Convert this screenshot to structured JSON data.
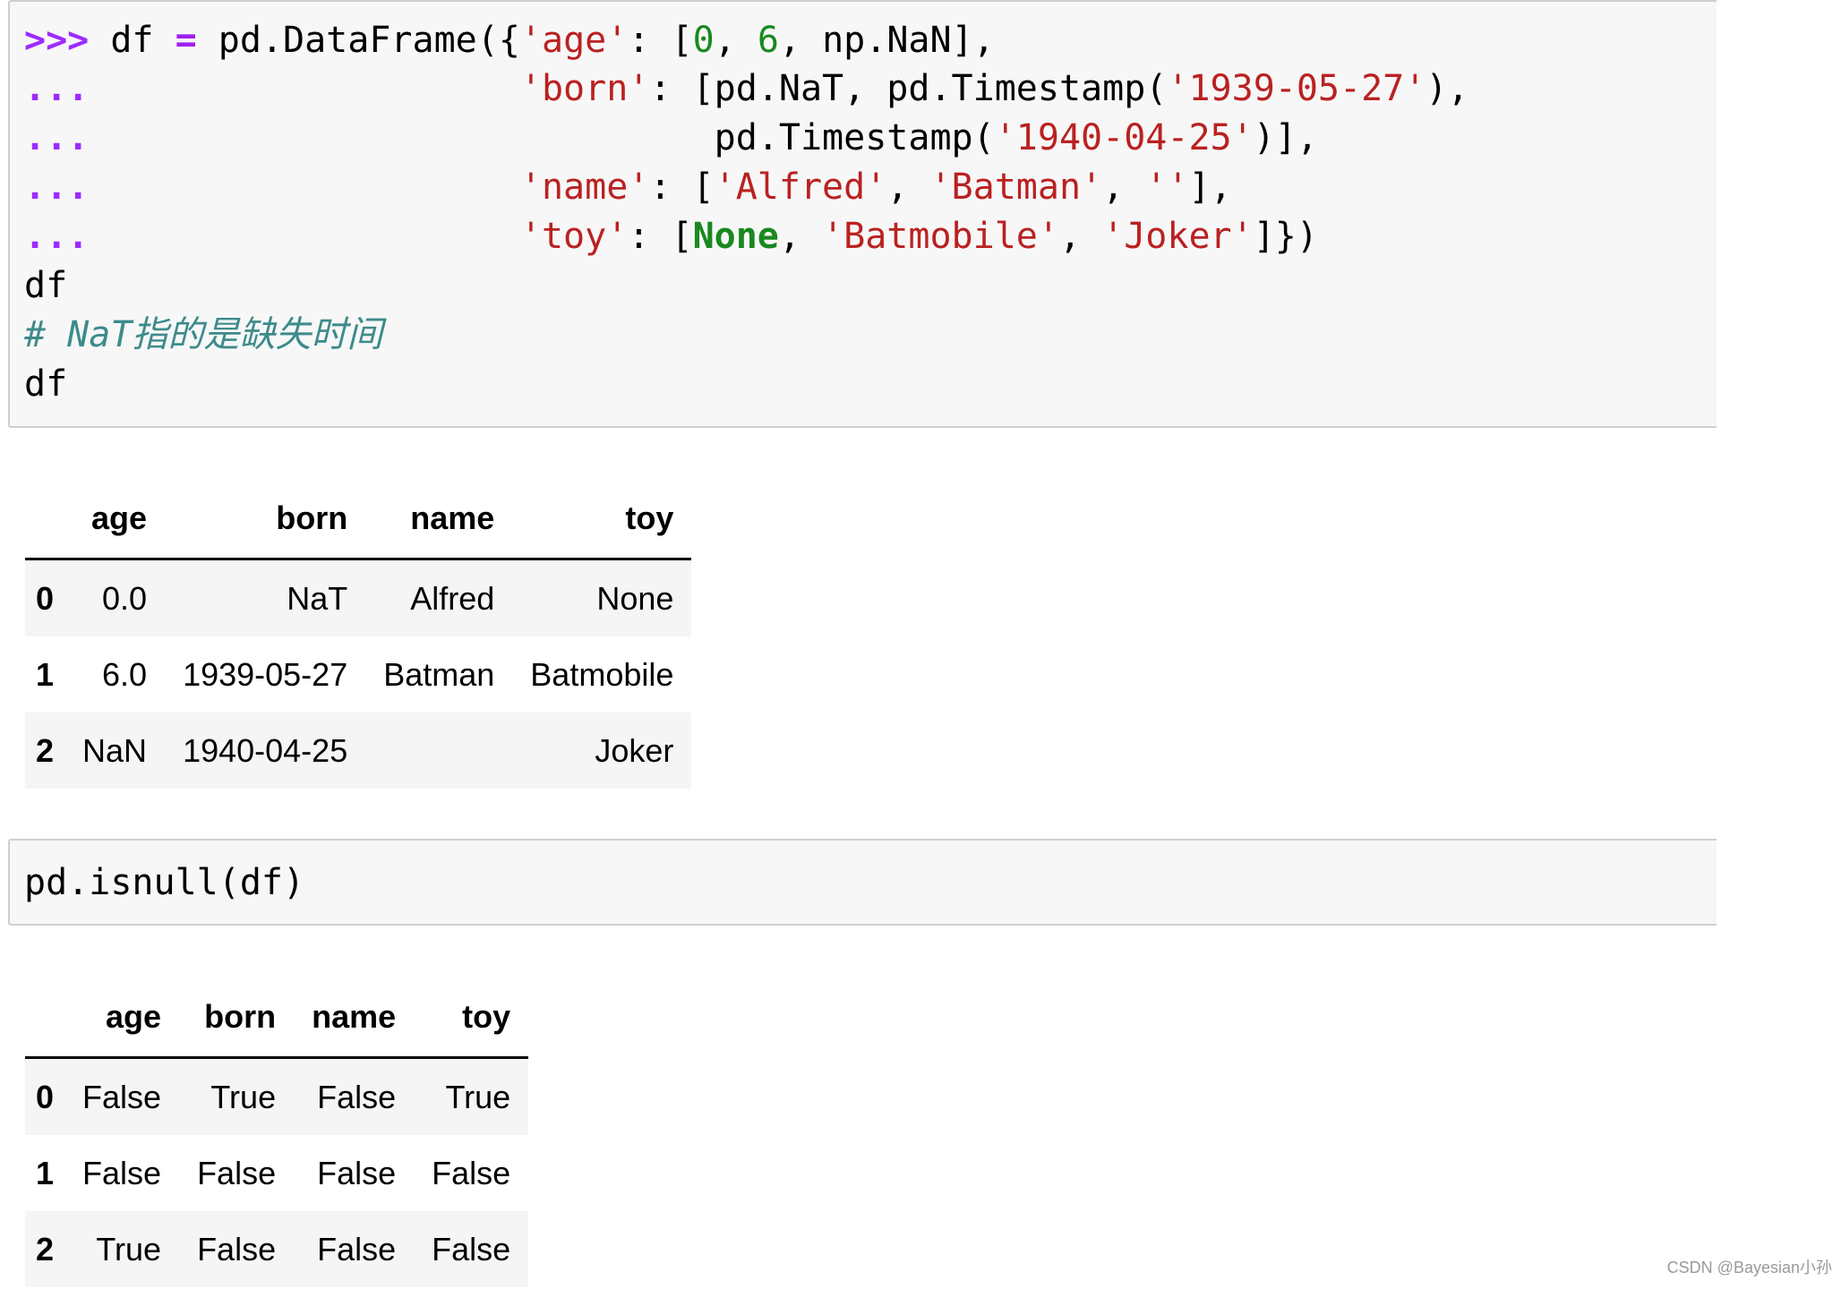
{
  "cell1": {
    "lines": [
      [
        {
          "t": ">>>",
          "c": "prompt"
        },
        {
          "t": " df "
        },
        {
          "t": "=",
          "c": "op"
        },
        {
          "t": " pd.DataFrame({"
        },
        {
          "t": "'age'",
          "c": "str"
        },
        {
          "t": ": ["
        },
        {
          "t": "0",
          "c": "num"
        },
        {
          "t": ", "
        },
        {
          "t": "6",
          "c": "num"
        },
        {
          "t": ", np.NaN],"
        }
      ],
      [
        {
          "t": "...",
          "c": "cont"
        },
        {
          "t": "                    "
        },
        {
          "t": "'born'",
          "c": "str"
        },
        {
          "t": ": [pd.NaT, pd.Timestamp("
        },
        {
          "t": "'1939-05-27'",
          "c": "str"
        },
        {
          "t": "),"
        }
      ],
      [
        {
          "t": "...",
          "c": "cont"
        },
        {
          "t": "                             pd.Timestamp("
        },
        {
          "t": "'1940-04-25'",
          "c": "str"
        },
        {
          "t": ")],"
        }
      ],
      [
        {
          "t": "...",
          "c": "cont"
        },
        {
          "t": "                    "
        },
        {
          "t": "'name'",
          "c": "str"
        },
        {
          "t": ": ["
        },
        {
          "t": "'Alfred'",
          "c": "str"
        },
        {
          "t": ", "
        },
        {
          "t": "'Batman'",
          "c": "str"
        },
        {
          "t": ", "
        },
        {
          "t": "''",
          "c": "str"
        },
        {
          "t": "],"
        }
      ],
      [
        {
          "t": "...",
          "c": "cont"
        },
        {
          "t": "                    "
        },
        {
          "t": "'toy'",
          "c": "str"
        },
        {
          "t": ": ["
        },
        {
          "t": "None",
          "c": "kw"
        },
        {
          "t": ", "
        },
        {
          "t": "'Batmobile'",
          "c": "str"
        },
        {
          "t": ", "
        },
        {
          "t": "'Joker'",
          "c": "str"
        },
        {
          "t": "]})"
        }
      ],
      [
        {
          "t": "df"
        }
      ],
      [
        {
          "t": "# NaT指的是缺失时间",
          "c": "comment"
        }
      ],
      [
        {
          "t": "df"
        }
      ]
    ]
  },
  "table1": {
    "columns": [
      "age",
      "born",
      "name",
      "toy"
    ],
    "rows": [
      {
        "index": "0",
        "cells": [
          "0.0",
          "NaT",
          "Alfred",
          "None"
        ]
      },
      {
        "index": "1",
        "cells": [
          "6.0",
          "1939-05-27",
          "Batman",
          "Batmobile"
        ]
      },
      {
        "index": "2",
        "cells": [
          "NaN",
          "1940-04-25",
          "",
          "Joker"
        ]
      }
    ]
  },
  "cell2": {
    "lines": [
      [
        {
          "t": "pd.isnull(df)"
        }
      ]
    ]
  },
  "table2": {
    "columns": [
      "age",
      "born",
      "name",
      "toy"
    ],
    "rows": [
      {
        "index": "0",
        "cells": [
          "False",
          "True",
          "False",
          "True"
        ]
      },
      {
        "index": "1",
        "cells": [
          "False",
          "False",
          "False",
          "False"
        ]
      },
      {
        "index": "2",
        "cells": [
          "True",
          "False",
          "False",
          "False"
        ]
      }
    ]
  },
  "watermark": "CSDN @Bayesian小孙"
}
